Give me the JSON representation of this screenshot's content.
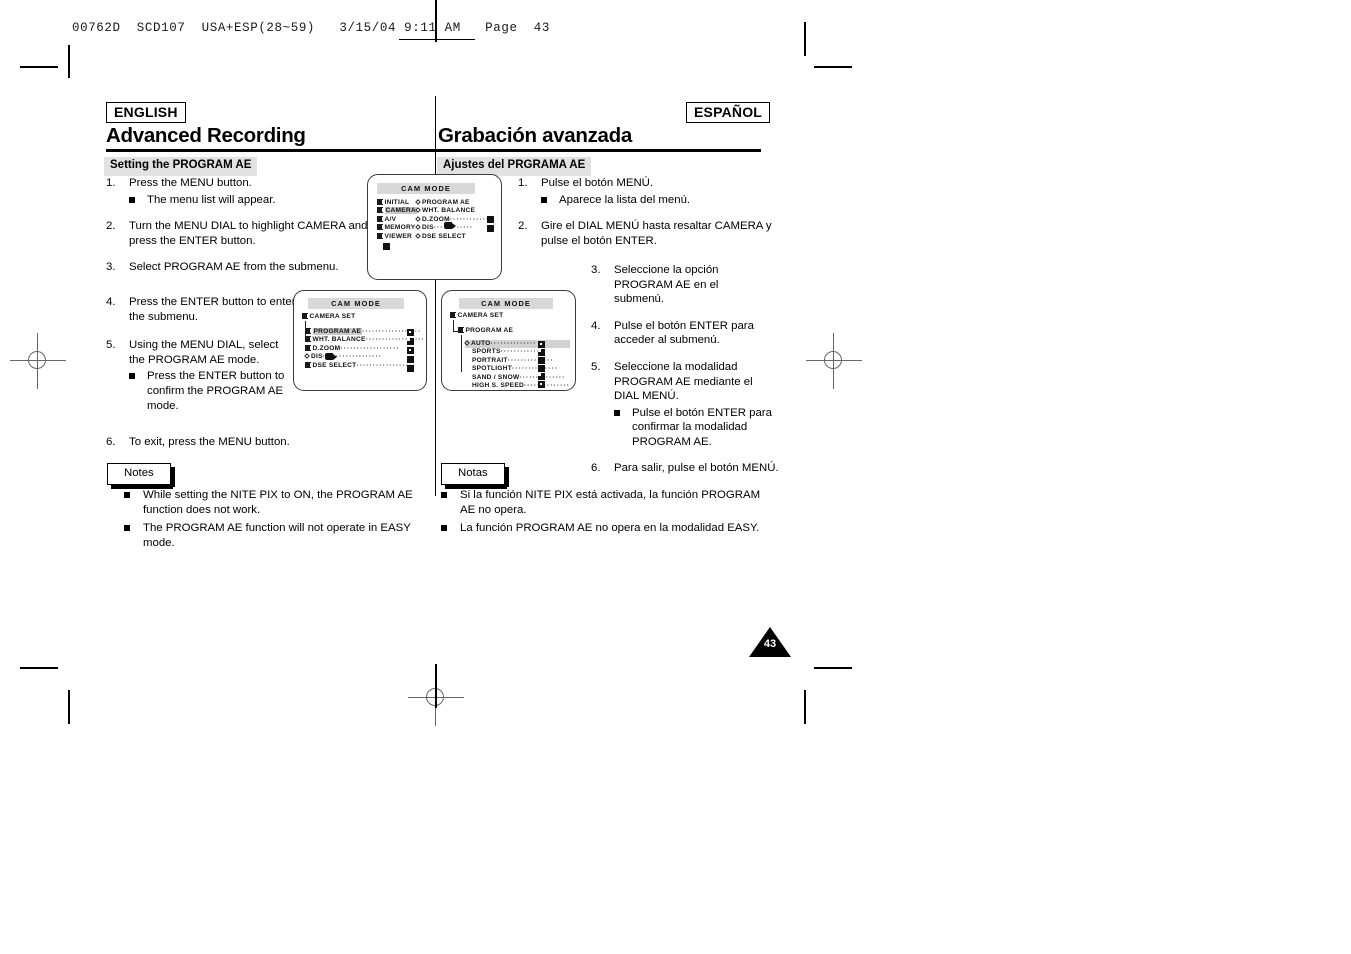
{
  "slug": {
    "text": "00762D  SCD107  USA+ESP(28~59)   3/15/04 9:11 AM   Page  43"
  },
  "page_number": "43",
  "english": {
    "badge": "ENGLISH",
    "chapter_title": "Advanced Recording",
    "section_title": "Setting the PROGRAM AE",
    "steps": [
      {
        "num": "1.",
        "text": "Press the MENU button.",
        "subs": [
          "The menu list will appear."
        ]
      },
      {
        "num": "2.",
        "text": "Turn the MENU DIAL to highlight CAMERA and press the ENTER button.",
        "subs": []
      },
      {
        "num": "3.",
        "text": "Select PROGRAM AE from the submenu.",
        "subs": []
      },
      {
        "num": "4.",
        "text": "Press the ENTER button to enter the submenu.",
        "subs": []
      },
      {
        "num": "5.",
        "text": "Using the MENU DIAL, select the PROGRAM AE mode.",
        "subs": [
          "Press the ENTER button to confirm the PROGRAM AE mode."
        ]
      },
      {
        "num": "6.",
        "text": "To exit, press the MENU button.",
        "subs": []
      }
    ],
    "notes_label": "Notes",
    "notes": [
      "While setting the NITE PIX to ON, the PROGRAM AE function does not work.",
      "The PROGRAM AE function will not operate in EASY mode."
    ]
  },
  "spanish": {
    "badge": "ESPAÑOL",
    "chapter_title": "Grabación avanzada",
    "section_title": "Ajustes del PRGRAMA AE",
    "steps": [
      {
        "num": "1.",
        "text": "Pulse el botón MENÚ.",
        "subs": [
          "Aparece la lista del menú."
        ]
      },
      {
        "num": "2.",
        "text": "Gire el DIAL MENÚ hasta resaltar CAMERA y pulse el botón ENTER.",
        "subs": []
      },
      {
        "num": "3.",
        "text": "Seleccione la opción PROGRAM AE en el submenú.",
        "subs": []
      },
      {
        "num": "4.",
        "text": "Pulse el botón ENTER para acceder al submenú.",
        "subs": []
      },
      {
        "num": "5.",
        "text": "Seleccione la modalidad PROGRAM AE mediante el DIAL MENÚ.",
        "subs": [
          "Pulse el botón ENTER para confirmar la modalidad PROGRAM AE."
        ]
      },
      {
        "num": "6.",
        "text": "Para salir, pulse el botón MENÚ.",
        "subs": []
      }
    ],
    "notes_label": "Notas",
    "notes": [
      "Si la función NITE PIX está activada, la función PROGRAM AE no opera.",
      "La función PROGRAM AE no opera en la modalidad EASY."
    ]
  },
  "screens": {
    "main_menu": {
      "title": "CAM MODE",
      "left_items": [
        "INITIAL",
        "CAMERA",
        "A/V",
        "MEMORY",
        "VIEWER"
      ],
      "highlighted_left": "CAMERA",
      "right_items": [
        "PROGRAM AE",
        "WHT. BALANCE",
        "D.ZOOM",
        "DIS",
        "DSE SELECT"
      ],
      "dots": "············"
    },
    "camera_set": {
      "title": "CAM MODE",
      "header": "CAMERA SET",
      "items": [
        "PROGRAM AE",
        "WHT. BALANCE",
        "D.ZOOM",
        "DIS",
        "DSE SELECT"
      ],
      "highlighted_item": "PROGRAM AE",
      "dots": "··················"
    },
    "program_ae": {
      "title": "CAM MODE",
      "header": "CAMERA SET",
      "subheader": "PROGRAM AE",
      "options": [
        "AUTO",
        "SPORTS",
        "PORTRAIT",
        "SPOTLIGHT",
        "SAND / SNOW",
        "HIGH S. SPEED"
      ],
      "selected_option": "AUTO",
      "dots": "··············"
    }
  },
  "colors": {
    "ink": "#000000",
    "section_bar": "#e2e2e2",
    "osd_bar": "#d8d8d8",
    "osd_highlight": "#c9c9c9"
  }
}
